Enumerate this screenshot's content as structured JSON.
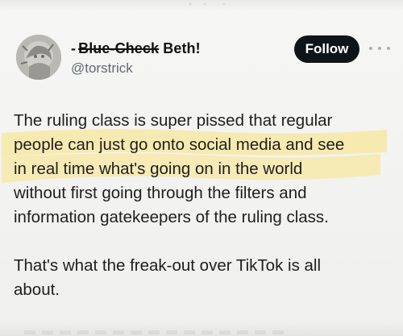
{
  "post": {
    "author": {
      "name_prefix": "-",
      "name_struck": "Blue-Check",
      "name_rest": "Beth!",
      "handle": "@torstrick",
      "avatar_icon": "profile-photo-avatar"
    },
    "follow_label": "Follow",
    "more_icon": "more-options-ellipsis-icon",
    "paragraphs": [
      "The ruling class is super pissed that regular\npeople can just go onto social media and see\nin real time what's going on in the world\nwithout first going through the filters and\ninformation gatekeepers of the ruling class.",
      "That's what the freak-out over TikTok is all\nabout."
    ],
    "highlight_color": "#f9d94a"
  }
}
